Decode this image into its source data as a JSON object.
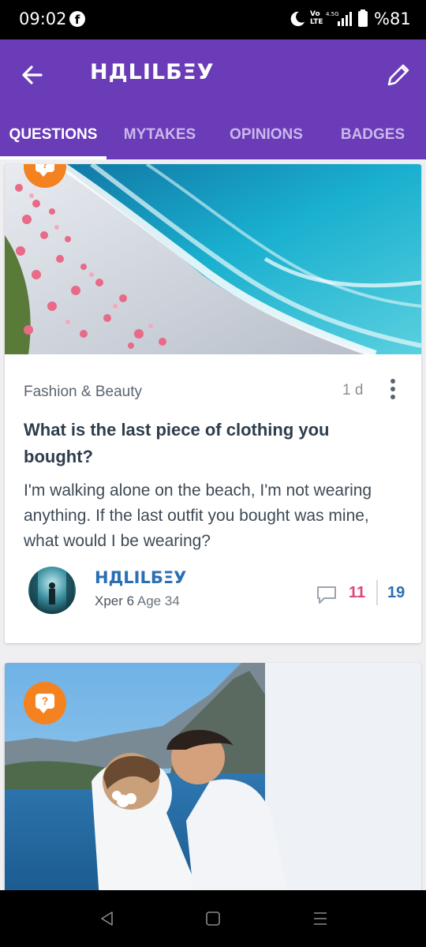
{
  "status_bar": {
    "time": "09:02",
    "volte_top": "Vo",
    "volte_bottom": "LTE",
    "network": "4.5G",
    "battery": "%81"
  },
  "app_bar": {
    "title": "НДLILБΞУ",
    "tabs": [
      "QUESTIONS",
      "MYTAKES",
      "OPINIONS",
      "BADGES"
    ],
    "active_tab": "QUESTIONS"
  },
  "posts": [
    {
      "category": "Fashion & Beauty",
      "age": "1 d",
      "title": "What is the last piece of clothing you bought?",
      "body": "I'm walking alone on the beach, I'm not wearing anything. If the last outfit you bought was mine, what would I be wearing?",
      "author": {
        "name": "НДLILБΞУ",
        "rank": "Xper 6",
        "age_label": "Age 34"
      },
      "comment_count": "11",
      "opinion_count": "19"
    }
  ],
  "colors": {
    "brand_purple": "#6b3cb8",
    "badge_orange": "#f58220",
    "comment_pink": "#e0457b",
    "link_blue": "#2b6fb3"
  },
  "icons": [
    "facebook-icon",
    "moon-icon",
    "signal-icon",
    "battery-icon",
    "back-arrow-icon",
    "pencil-icon",
    "question-bubble-icon",
    "more-vert-icon",
    "comment-icon",
    "nav-back-icon",
    "nav-home-icon",
    "nav-recent-icon"
  ]
}
